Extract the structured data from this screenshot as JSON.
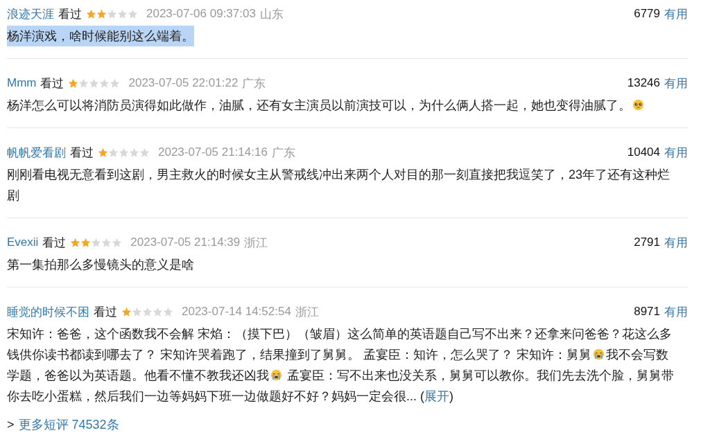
{
  "comments": [
    {
      "user": "浪迹天涯",
      "status": "看过",
      "stars": 2,
      "time": "2023-07-06 09:37:03",
      "location": "山东",
      "votes": "6779",
      "useful": "有用",
      "highlighted": true,
      "content": [
        {
          "kind": "text",
          "text": "杨洋演戏，啥时候能别这么端着。"
        }
      ]
    },
    {
      "user": "Mmm",
      "status": "看过",
      "stars": 1,
      "time": "2023-07-05 22:01:22",
      "location": "广东",
      "votes": "13246",
      "useful": "有用",
      "highlighted": false,
      "content": [
        {
          "kind": "text",
          "text": "杨洋怎么可以将消防员演得如此做作，油腻，还有女主演员以前演技可以，为什么俩人搭一起，她也变得油腻了。"
        },
        {
          "kind": "pleading"
        }
      ]
    },
    {
      "user": "帆帆爱看剧",
      "status": "看过",
      "stars": 1,
      "time": "2023-07-05 21:14:16",
      "location": "广东",
      "votes": "10404",
      "useful": "有用",
      "highlighted": false,
      "content": [
        {
          "kind": "text",
          "text": "刚刚看电视无意看到这剧，男主救火的时候女主从警戒线冲出来两个人对目的那一刻直接把我逗笑了，23年了还有这种烂剧"
        }
      ]
    },
    {
      "user": "Evexii",
      "status": "看过",
      "stars": 2,
      "time": "2023-07-05 21:14:39",
      "location": "浙江",
      "votes": "2791",
      "useful": "有用",
      "highlighted": false,
      "content": [
        {
          "kind": "text",
          "text": "第一集拍那么多慢镜头的意义是啥"
        }
      ]
    },
    {
      "user": "睡觉的时候不困",
      "status": "看过",
      "stars": 1,
      "time": "2023-07-14 14:52:54",
      "location": "浙江",
      "votes": "8971",
      "useful": "有用",
      "highlighted": false,
      "content": [
        {
          "kind": "text",
          "text": "宋知许：爸爸，这个函数我不会解 宋焰：（摸下巴）（皱眉）这么简单的英语题自己写不出来？还拿来问爸爸？花这么多钱供你读书都读到哪去了？ 宋知许哭着跑了，结果撞到了舅舅。 孟宴臣：知许，怎么哭了？ 宋知许：舅舅"
        },
        {
          "kind": "crying"
        },
        {
          "kind": "text",
          "text": "我不会写数学题，爸爸以为英语题。他看不懂不教我还凶我"
        },
        {
          "kind": "crying"
        },
        {
          "kind": "text",
          "text": " 孟宴臣：写不出来也没关系，舅舅可以教你。我们先去洗个脸，舅舅带你去吃小蛋糕，然后我们一边等妈妈下班一边做题好不好？妈妈一定会很... ("
        },
        {
          "kind": "link",
          "text": "展开"
        },
        {
          "kind": "text",
          "text": ")"
        }
      ]
    }
  ],
  "more": {
    "arrow": ">",
    "link": "更多短评 74532条"
  }
}
